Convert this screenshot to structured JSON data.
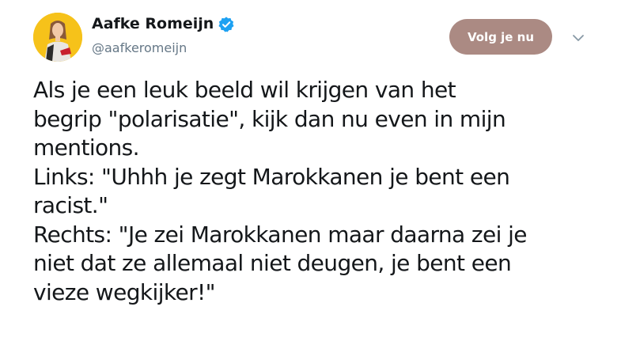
{
  "user": {
    "display_name": "Aafke Romeijn",
    "handle": "@aafkeromeijn",
    "verified": true
  },
  "follow_button": {
    "label": "Volg je nu"
  },
  "tweet": {
    "lines": [
      "Als je een leuk beeld wil krijgen van het",
      "begrip \"polarisatie\", kijk dan nu even in mijn",
      "mentions.",
      "Links: \"Uhhh je zegt Marokkanen je bent een",
      "racist.\"",
      "Rechts: \"Je zei Marokkanen maar daarna zei je",
      "niet dat ze allemaal niet deugen, je bent een",
      "vieze wegkijker!\""
    ]
  },
  "icons": {
    "verified": "verified-badge-icon",
    "caret": "chevron-down-icon"
  },
  "colors": {
    "follow_button_bg": "#ab8a83",
    "verified_blue": "#1da1f2",
    "handle_gray": "#657786",
    "text": "#14171a"
  }
}
